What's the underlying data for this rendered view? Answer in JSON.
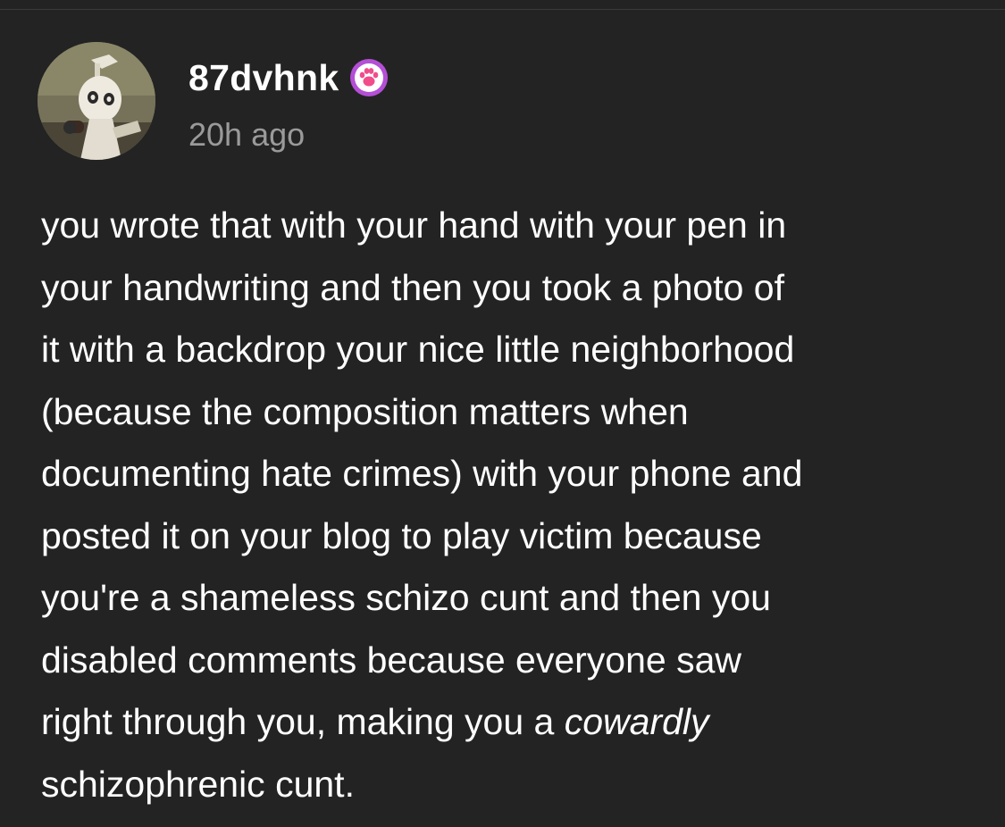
{
  "post": {
    "username": "87dvhnk",
    "timestamp": "20h ago",
    "badge_icon": "paw-print-badge-icon",
    "avatar_icon": "skeleton-figure-avatar",
    "body_lines": [
      "you wrote that with your hand with your pen in",
      "your handwriting and then you took a photo of",
      "it with a backdrop your nice little neighborhood",
      "(because the composition matters when",
      "documenting hate crimes) with your phone and",
      "posted it on your blog to play victim because",
      "you're a shameless schizo cunt and then you",
      "disabled comments because everyone saw"
    ],
    "line9_prefix": "right through you, making you a ",
    "line9_emphasis": "cowardly",
    "line10": "schizophrenic cunt."
  },
  "colors": {
    "background": "#232323",
    "text": "#ffffff",
    "timestamp": "#9a9a9a",
    "badge": "#b44fd6"
  }
}
